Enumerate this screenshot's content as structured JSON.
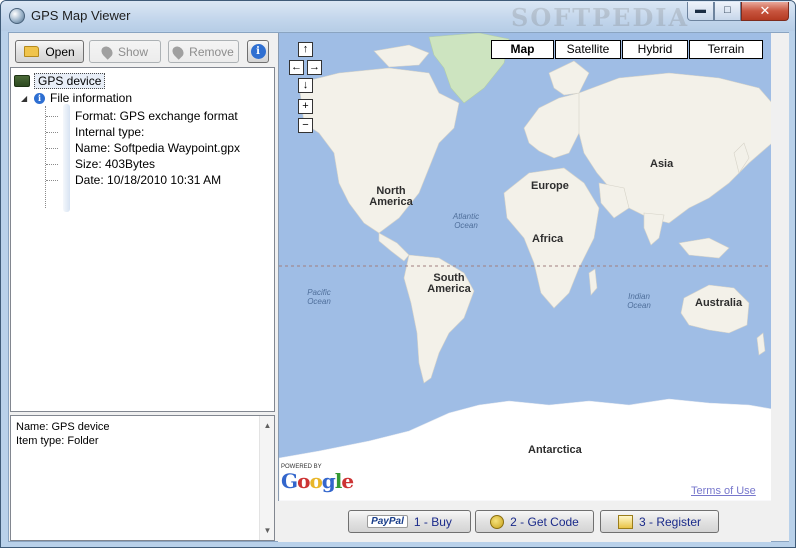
{
  "window": {
    "title": "GPS Map Viewer",
    "watermark": "SOFTPEDIA",
    "minimize": "▬",
    "maximize": "□",
    "close": "✕"
  },
  "toolbar": {
    "open_label": "Open",
    "show_label": "Show",
    "remove_label": "Remove",
    "info_label": "i"
  },
  "tree": {
    "root_label": "GPS device",
    "file_label": "File information",
    "leaves": [
      "Format: GPS exchange format",
      "Internal type:",
      "Name: Softpedia Waypoint.gpx",
      "Size: 403Bytes",
      "Date: 10/18/2010 10:31 AM"
    ]
  },
  "info_panel": {
    "lines": [
      "Name: GPS device",
      "Item type: Folder"
    ]
  },
  "map": {
    "types": [
      "Map",
      "Satellite",
      "Hybrid",
      "Terrain"
    ],
    "selected_type": "Map",
    "nav": {
      "up": "↑",
      "left": "←",
      "right": "→",
      "down": "↓",
      "zoom_in": "+",
      "zoom_out": "−"
    },
    "continents": [
      "North America",
      "South America",
      "Europe",
      "Africa",
      "Asia",
      "Australia",
      "Antarctica"
    ],
    "oceans": [
      "Atlantic Ocean",
      "Pacific Ocean",
      "Indian Ocean"
    ],
    "powered_by": "POWERED BY",
    "logo": "Google",
    "terms": "Terms of Use",
    "colors": {
      "water": "#9fbde5",
      "land": "#f3f1e9",
      "ice": "#ffffff",
      "greenland": "#cde4c0"
    }
  },
  "bottom": {
    "buy_label": "1 - Buy",
    "paypal": "PayPal",
    "code_label": "2 - Get Code",
    "register_label": "3 - Register"
  }
}
